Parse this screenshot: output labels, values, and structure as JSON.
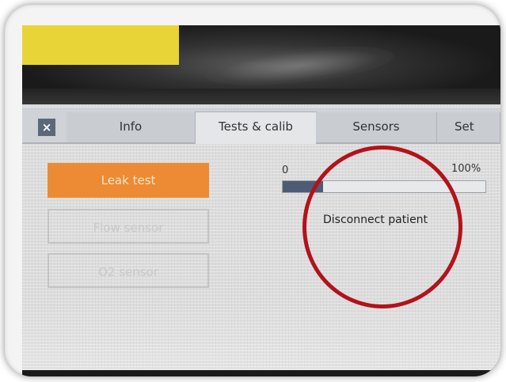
{
  "tabs": {
    "close_label": "×",
    "info": "Info",
    "tests": "Tests & calib",
    "sensors": "Sensors",
    "settings": "Set"
  },
  "buttons": {
    "leak_test": "Leak test",
    "flow_sensor": "Flow sensor",
    "o2_sensor": "O2 sensor"
  },
  "progress": {
    "min_label": "0",
    "max_label": "100%",
    "value_fraction": 0.2
  },
  "status": {
    "message": "Disconnect patient"
  },
  "colors": {
    "accent_orange": "#ec8b33",
    "progress_fill": "#4d5c75",
    "annotation_red": "#b3121b",
    "close_button": "#5c6878"
  }
}
